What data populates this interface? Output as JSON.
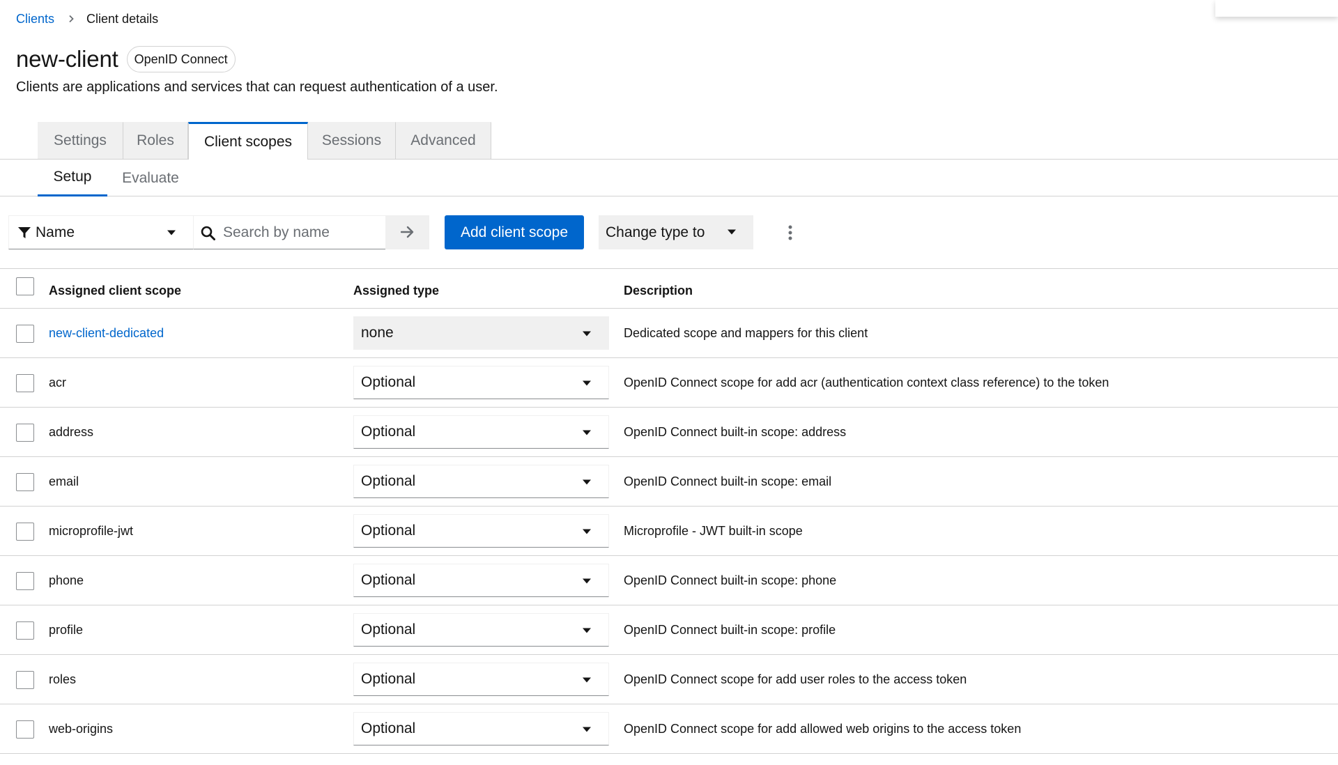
{
  "breadcrumb": {
    "parent": "Clients",
    "current": "Client details"
  },
  "header": {
    "title": "new-client",
    "protocol_badge": "OpenID Connect",
    "description": "Clients are applications and services that can request authentication of a user."
  },
  "tabs": [
    {
      "label": "Settings",
      "active": false
    },
    {
      "label": "Roles",
      "active": false
    },
    {
      "label": "Client scopes",
      "active": true
    },
    {
      "label": "Sessions",
      "active": false
    },
    {
      "label": "Advanced",
      "active": false
    }
  ],
  "subtabs": [
    {
      "label": "Setup",
      "active": true
    },
    {
      "label": "Evaluate",
      "active": false
    }
  ],
  "toolbar": {
    "filter_label": "Name",
    "search_placeholder": "Search by name",
    "add_button": "Add client scope",
    "change_type": "Change type to"
  },
  "table": {
    "headers": {
      "name": "Assigned client scope",
      "type": "Assigned type",
      "description": "Description"
    },
    "rows": [
      {
        "name": "new-client-dedicated",
        "type": "none",
        "description": "Dedicated scope and mappers for this client",
        "is_link": true
      },
      {
        "name": "acr",
        "type": "Optional",
        "description": "OpenID Connect scope for add acr (authentication context class reference) to the token",
        "is_link": false
      },
      {
        "name": "address",
        "type": "Optional",
        "description": "OpenID Connect built-in scope: address",
        "is_link": false
      },
      {
        "name": "email",
        "type": "Optional",
        "description": "OpenID Connect built-in scope: email",
        "is_link": false
      },
      {
        "name": "microprofile-jwt",
        "type": "Optional",
        "description": "Microprofile - JWT built-in scope",
        "is_link": false
      },
      {
        "name": "phone",
        "type": "Optional",
        "description": "OpenID Connect built-in scope: phone",
        "is_link": false
      },
      {
        "name": "profile",
        "type": "Optional",
        "description": "OpenID Connect built-in scope: profile",
        "is_link": false
      },
      {
        "name": "roles",
        "type": "Optional",
        "description": "OpenID Connect scope for add user roles to the access token",
        "is_link": false
      },
      {
        "name": "web-origins",
        "type": "Optional",
        "description": "OpenID Connect scope for add allowed web origins to the access token",
        "is_link": false
      }
    ]
  },
  "colors": {
    "accent": "#0066cc",
    "text": "#151515",
    "muted": "#6a6e73",
    "border": "#d2d2d2",
    "tab_background": "#f0f0f0"
  },
  "icons": {
    "breadcrumb_separator": "chevron-right-icon",
    "filter": "funnel-icon",
    "dropdown": "caret-down-icon",
    "search": "search-icon",
    "search_submit": "arrow-right-icon",
    "more_actions": "kebab-icon"
  }
}
